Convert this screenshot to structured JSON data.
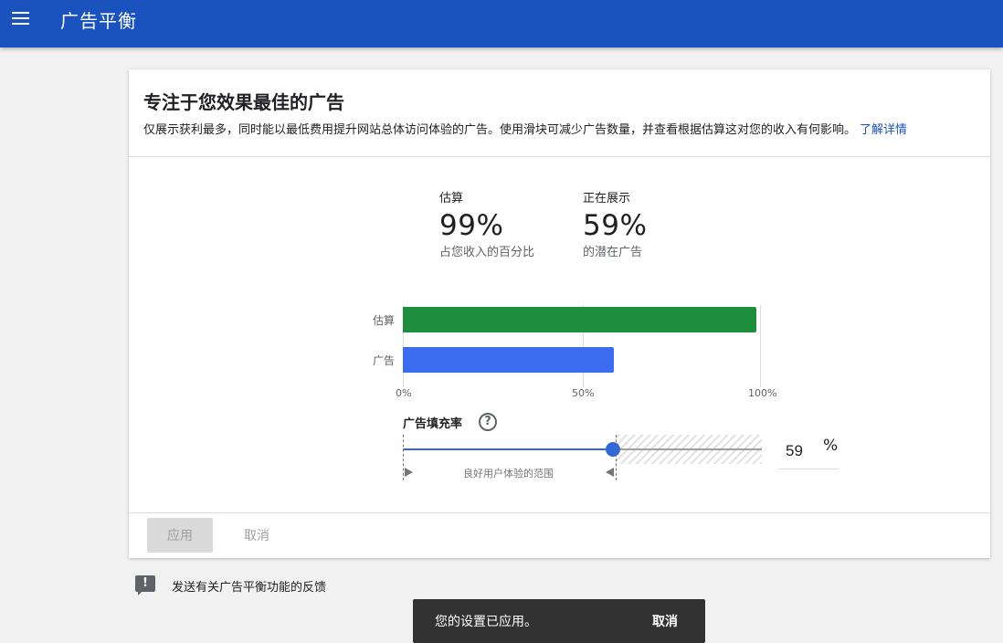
{
  "app": {
    "title": "广告平衡"
  },
  "card": {
    "title": "专注于您效果最佳的广告",
    "description": "仅展示获利最多，同时能以最低费用提升网站总体访问体验的广告。使用滑块可减少广告数量，并查看根据估算这对您的收入有何影响。",
    "learn_more": "了解详情"
  },
  "stats": [
    {
      "label": "估算",
      "value": "99%",
      "sub": "占您收入的百分比"
    },
    {
      "label": "正在展示",
      "value": "59%",
      "sub": "的潜在广告"
    }
  ],
  "chart_data": {
    "type": "bar",
    "orientation": "horizontal",
    "categories": [
      "估算",
      "广告"
    ],
    "values": [
      99,
      59
    ],
    "colors": [
      "#1e8e3e",
      "#3b6cf0"
    ],
    "xlim": [
      0,
      100
    ],
    "ticks": [
      "0%",
      "50%",
      "100%"
    ],
    "grid": true
  },
  "fill_rate": {
    "label": "广告填充率",
    "help_icon": "help-circle-icon",
    "value": 59,
    "input_value": "59",
    "unit": "%",
    "good_range_label": "良好用户体验的范围",
    "good_range_max": 60
  },
  "actions": {
    "apply": "应用",
    "cancel": "取消"
  },
  "feedback": {
    "text": "发送有关广告平衡功能的反馈",
    "icon": "feedback-icon"
  },
  "snackbar": {
    "message": "您的设置已应用。",
    "action": "取消"
  }
}
